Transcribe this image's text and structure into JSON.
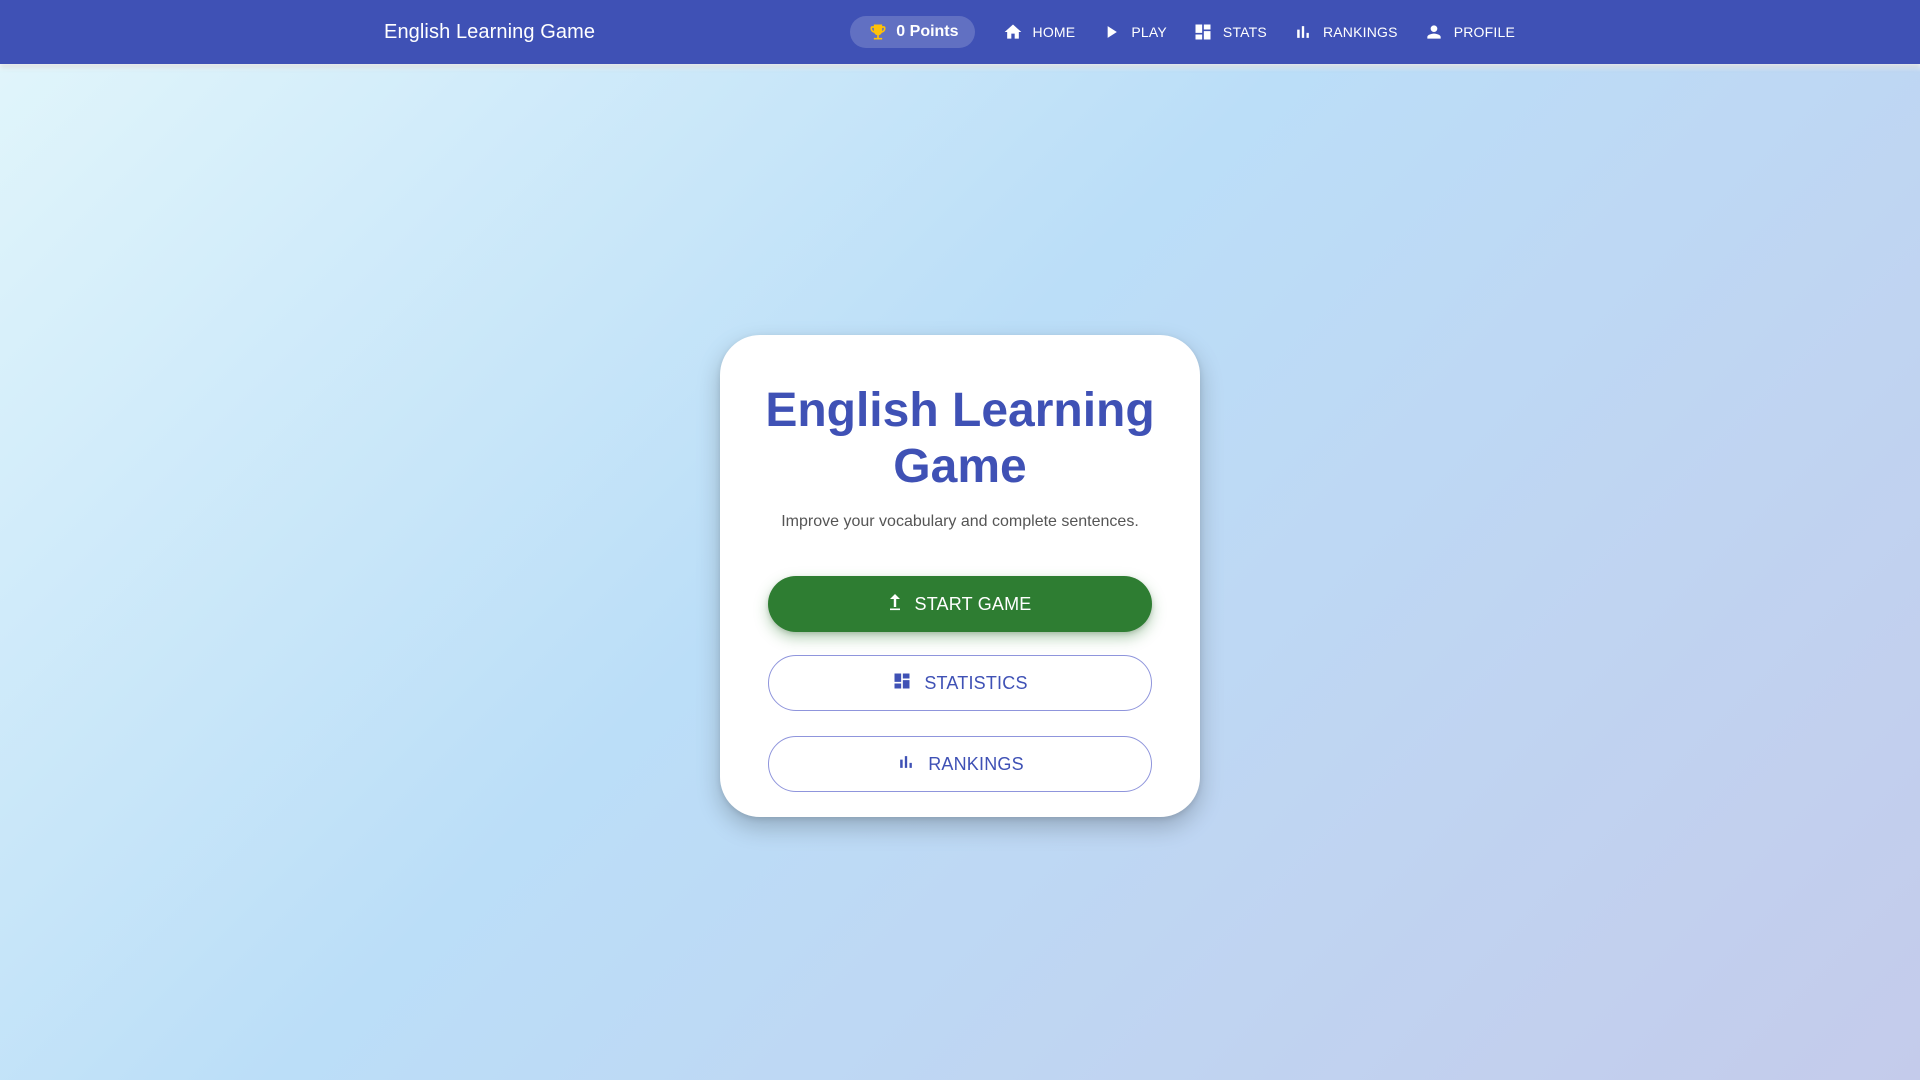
{
  "header": {
    "title": "English Learning Game",
    "points_label": "0 Points",
    "points_icon": "trophy-icon",
    "nav": [
      {
        "label": "HOME",
        "icon": "home-icon"
      },
      {
        "label": "PLAY",
        "icon": "play-icon"
      },
      {
        "label": "STATS",
        "icon": "dashboard-icon"
      },
      {
        "label": "RANKINGS",
        "icon": "bar-chart-icon"
      },
      {
        "label": "PROFILE",
        "icon": "person-icon"
      }
    ]
  },
  "main": {
    "title": "English Learning Game",
    "subtitle": "Improve your vocabulary and complete sentences.",
    "buttons": {
      "start": {
        "label": "START GAME",
        "icon": "arrow-up-icon"
      },
      "statistics": {
        "label": "STATISTICS",
        "icon": "dashboard-icon"
      },
      "rankings": {
        "label": "RANKINGS",
        "icon": "bar-chart-icon"
      }
    }
  },
  "colors": {
    "primary": "#3f51b5",
    "start_button": "#2e7d32",
    "trophy": "#ffc107",
    "background_start": "#e2f6fb",
    "background_end": "#c4cbeb"
  }
}
